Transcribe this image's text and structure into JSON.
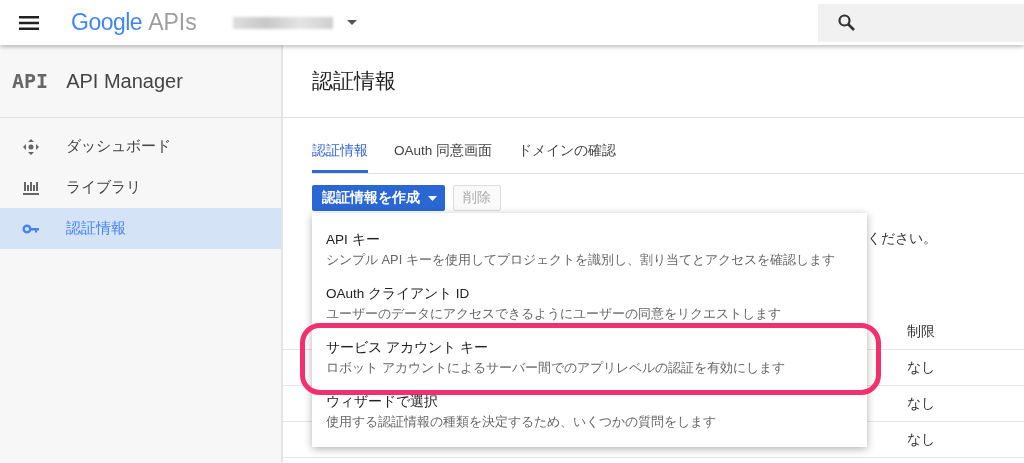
{
  "topbar": {
    "logo_brand": "Google",
    "logo_product": "APIs"
  },
  "sidebar": {
    "title": "API Manager",
    "badge": "API",
    "items": [
      {
        "label": "ダッシュボード",
        "kind": "dashboard",
        "selected": false
      },
      {
        "label": "ライブラリ",
        "kind": "library",
        "selected": false
      },
      {
        "label": "認証情報",
        "kind": "key",
        "selected": true
      }
    ]
  },
  "page": {
    "title": "認証情報"
  },
  "tabs": [
    {
      "label": "認証情報",
      "selected": true
    },
    {
      "label": "OAuth 同意画面",
      "selected": false
    },
    {
      "label": "ドメインの確認",
      "selected": false
    }
  ],
  "toolbar": {
    "create_button": "認証情報を作成",
    "delete_button": {
      "label": "削除",
      "disabled": true
    }
  },
  "hint_text_visible": "ください。",
  "table": {
    "column_restriction": "制限",
    "rows": [
      {
        "restriction": "なし"
      },
      {
        "restriction": "なし"
      },
      {
        "restriction": "なし"
      }
    ]
  },
  "menu": {
    "items": [
      {
        "title": "API キー",
        "description": "シンプル API キーを使用してプロジェクトを識別し、割り当てとアクセスを確認します",
        "highlighted": false
      },
      {
        "title": "OAuth クライアント ID",
        "description": "ユーザーのデータにアクセスできるようにユーザーの同意をリクエストします",
        "highlighted": false
      },
      {
        "title": "サービス アカウント キー",
        "description": "ロボット アカウントによるサーバー間でのアプリレベルの認証を有効にします",
        "highlighted": true
      },
      {
        "title": "ウィザードで選択",
        "description": "使用する認証情報の種類を決定するため、いくつかの質問をします",
        "highlighted": false
      }
    ]
  }
}
